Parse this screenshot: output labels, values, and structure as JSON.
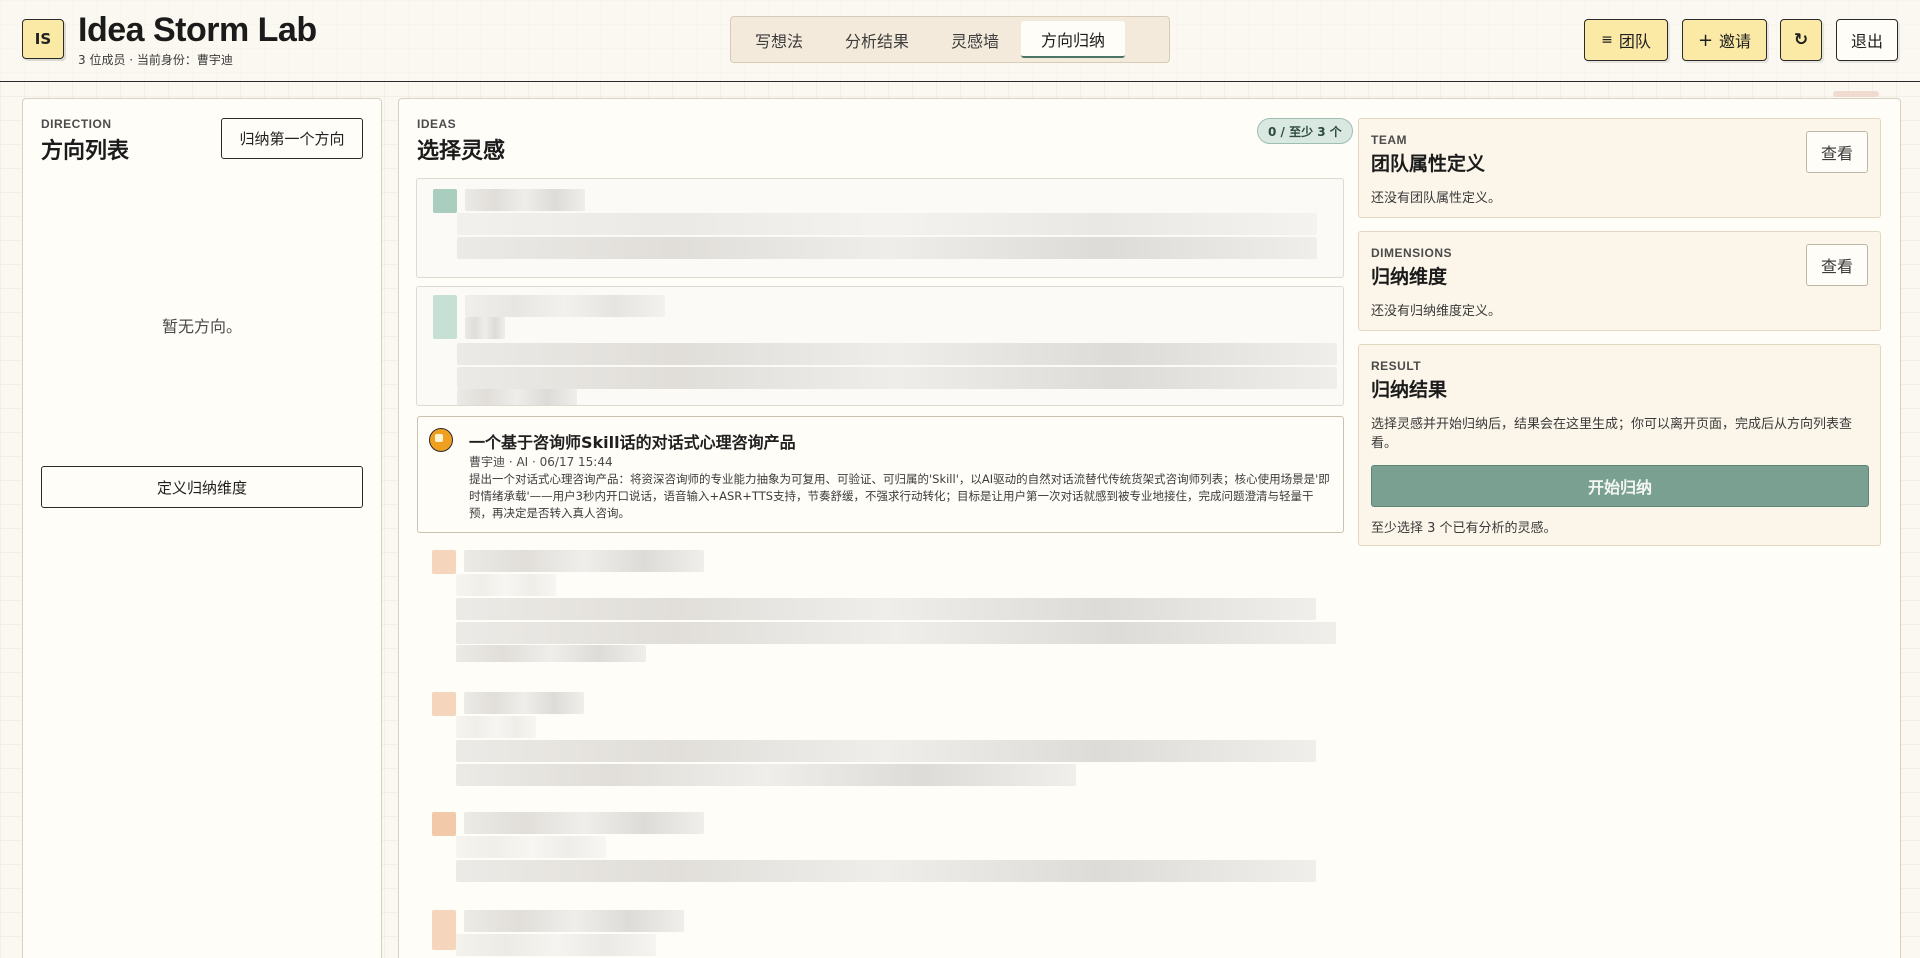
{
  "header": {
    "logo": "IS",
    "title": "Idea Storm Lab",
    "subtitle": "3 位成员 · 当前身份：曹宇迪",
    "tabs": [
      {
        "label": "写想法",
        "active": false
      },
      {
        "label": "分析结果",
        "active": false
      },
      {
        "label": "灵感墙",
        "active": false
      },
      {
        "label": "方向归纳",
        "active": true
      }
    ],
    "team_btn": "团队",
    "team_icon": "≡",
    "invite_btn": "邀请",
    "invite_icon": "+",
    "refresh_icon": "↻",
    "logout_btn": "退出"
  },
  "direction": {
    "eyebrow": "DIRECTION",
    "title": "方向列表",
    "summarize_btn": "归纳第一个方向",
    "empty": "暂无方向。",
    "define_btn": "定义归纳维度"
  },
  "ideas": {
    "eyebrow": "IDEAS",
    "title": "选择灵感",
    "count_badge": "0 / 至少 3 个",
    "visible_card": {
      "title": "一个基于咨询师Skill话的对话式心理咨询产品",
      "meta": "曹宇迪 · AI · 06/17 15:44",
      "body": "提出一个对话式心理咨询产品：将资深咨询师的专业能力抽象为可复用、可验证、可归属的'Skill'，以AI驱动的自然对话流替代传统货架式咨询师列表；核心使用场景是'即时情绪承载'——用户3秒内开口说话，语音输入+ASR+TTS支持，节奏舒缓，不强求行动转化；目标是让用户第一次对话就感到被专业地接住，完成问题澄清与轻量干预，再决定是否转入真人咨询。"
    }
  },
  "team_card": {
    "eyebrow": "TEAM",
    "title": "团队属性定义",
    "desc": "还没有团队属性定义。",
    "view_btn": "查看"
  },
  "dimensions_card": {
    "eyebrow": "DIMENSIONS",
    "title": "归纳维度",
    "desc": "还没有归纳维度定义。",
    "view_btn": "查看"
  },
  "result_card": {
    "eyebrow": "RESULT",
    "title": "归纳结果",
    "desc": "选择灵感并开始归纳后，结果会在这里生成；你可以离开页面，完成后从方向列表查看。",
    "start_btn": "开始归纳",
    "hint": "至少选择 3 个已有分析的灵感。"
  },
  "colors": {
    "accent_green": "#7aa091",
    "accent_yellow": "#fbe9a6",
    "background": "#fbf8f1"
  }
}
